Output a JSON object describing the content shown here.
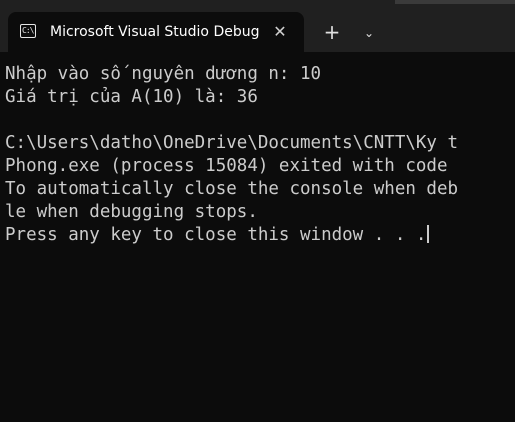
{
  "tab": {
    "title": "Microsoft Visual Studio Debug Console",
    "icon": "console-app-icon",
    "icon_glyph": "C:\\",
    "close_glyph": "✕"
  },
  "toolbar": {
    "new_tab_glyph": "+",
    "dropdown_glyph": "⌄"
  },
  "console": {
    "lines": [
      "Nhập vào số nguyên dương n: 10",
      "Giá trị của A(10) là: 36",
      "",
      "C:\\Users\\datho\\OneDrive\\Documents\\CNTT\\Ky t",
      "Phong.exe (process 15084) exited with code ",
      "To automatically close the console when deb",
      "le when debugging stops.",
      "Press any key to close this window . . ."
    ]
  },
  "colors": {
    "background": "#0c0c0c",
    "tabbar": "#202020",
    "text": "#cccccc"
  }
}
